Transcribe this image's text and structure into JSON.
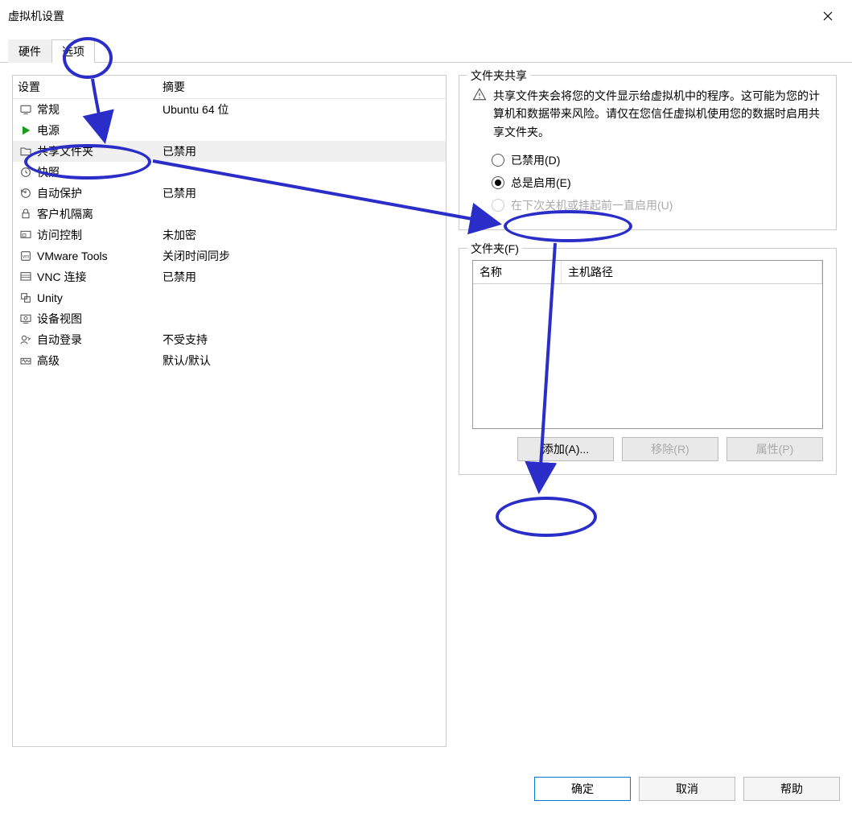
{
  "window": {
    "title": "虚拟机设置"
  },
  "tabs": {
    "hardware": "硬件",
    "options": "选项"
  },
  "list": {
    "header": {
      "setting": "设置",
      "summary": "摘要"
    },
    "rows": [
      {
        "label": "常规",
        "summary": "Ubuntu 64 位"
      },
      {
        "label": "电源",
        "summary": ""
      },
      {
        "label": "共享文件夹",
        "summary": "已禁用"
      },
      {
        "label": "快照",
        "summary": ""
      },
      {
        "label": "自动保护",
        "summary": "已禁用"
      },
      {
        "label": "客户机隔离",
        "summary": ""
      },
      {
        "label": "访问控制",
        "summary": "未加密"
      },
      {
        "label": "VMware Tools",
        "summary": "关闭时间同步"
      },
      {
        "label": "VNC 连接",
        "summary": "已禁用"
      },
      {
        "label": "Unity",
        "summary": ""
      },
      {
        "label": "设备视图",
        "summary": ""
      },
      {
        "label": "自动登录",
        "summary": "不受支持"
      },
      {
        "label": "高级",
        "summary": "默认/默认"
      }
    ],
    "selected_index": 2
  },
  "sharing": {
    "fieldset_title": "文件夹共享",
    "warning": "共享文件夹会将您的文件显示给虚拟机中的程序。这可能为您的计算机和数据带来风险。请仅在您信任虚拟机使用您的数据时启用共享文件夹。",
    "radios": {
      "disabled": "已禁用(D)",
      "always": "总是启用(E)",
      "until": "在下次关机或挂起前一直启用(U)"
    }
  },
  "folders": {
    "fieldset_title": "文件夹(F)",
    "columns": {
      "name": "名称",
      "host_path": "主机路径"
    },
    "buttons": {
      "add": "添加(A)...",
      "remove": "移除(R)",
      "props": "属性(P)"
    }
  },
  "footer": {
    "ok": "确定",
    "cancel": "取消",
    "help": "帮助"
  }
}
